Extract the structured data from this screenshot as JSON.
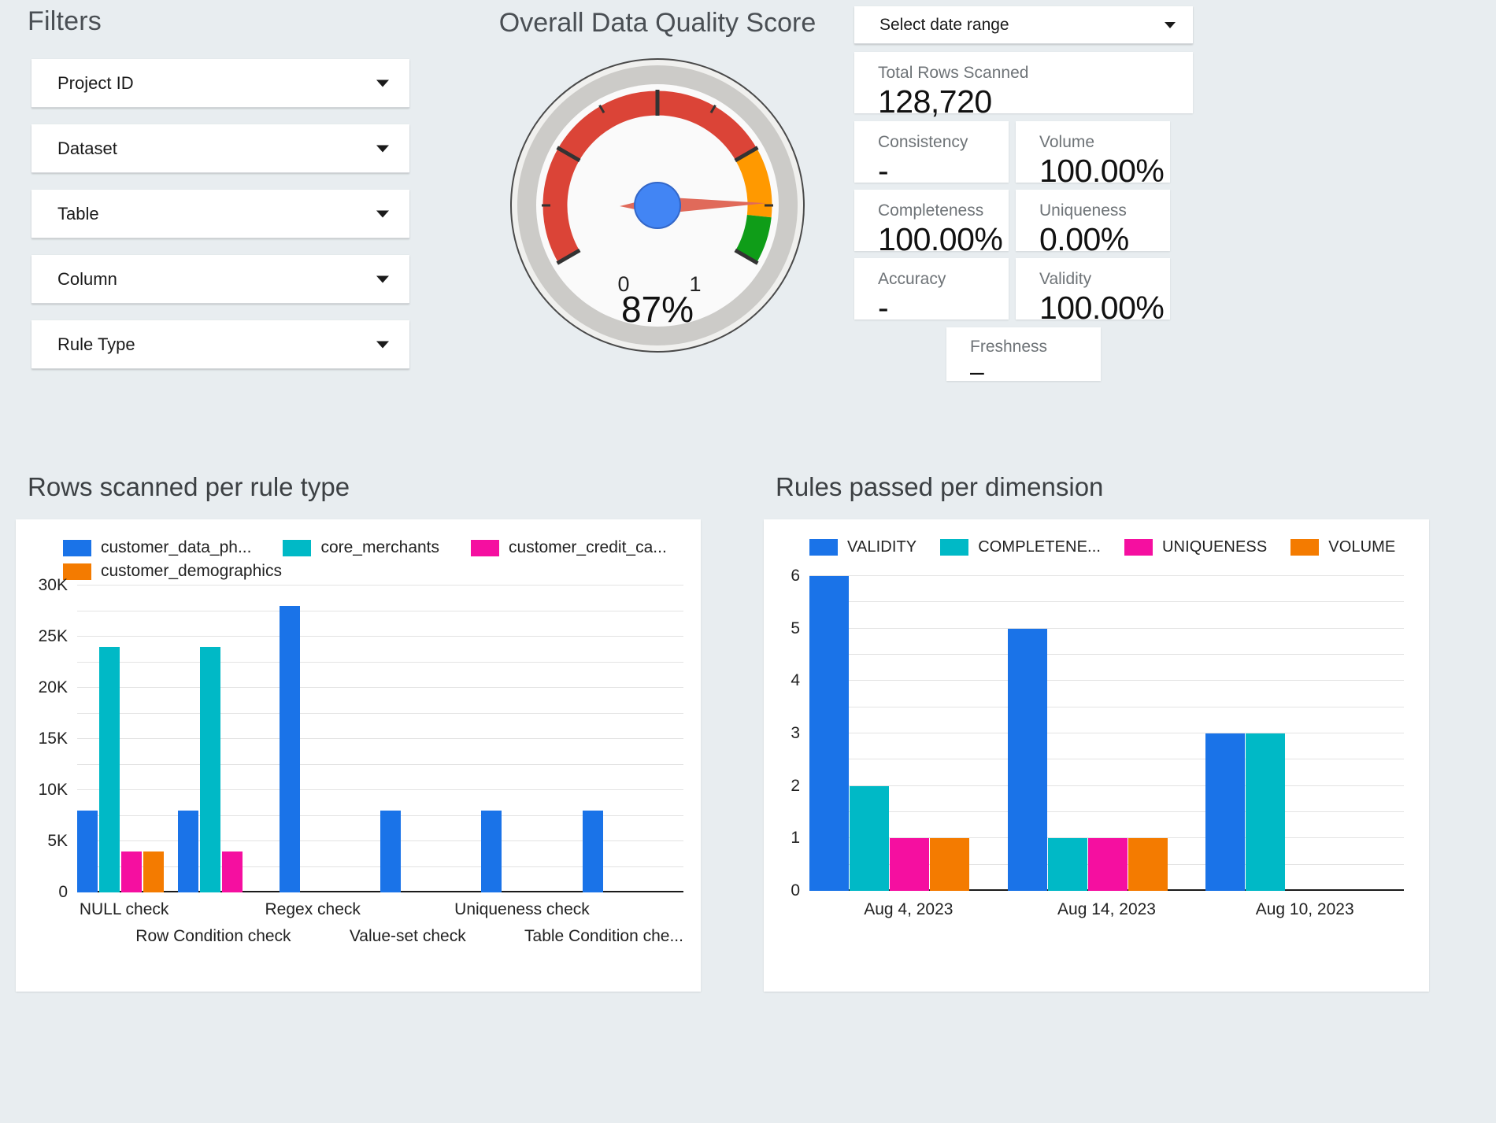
{
  "filters": {
    "title": "Filters",
    "items": [
      {
        "label": "Project ID",
        "icon": "chevron-down-icon"
      },
      {
        "label": "Dataset",
        "icon": "chevron-down-icon"
      },
      {
        "label": "Table",
        "icon": "chevron-down-icon"
      },
      {
        "label": "Column",
        "icon": "chevron-down-icon"
      },
      {
        "label": "Rule Type",
        "icon": "chevron-down-icon"
      }
    ]
  },
  "gauge": {
    "title": "Overall Data Quality Score",
    "value_label": "87%",
    "value": 0.87,
    "min_label": "0",
    "max_label": "1",
    "min": 0,
    "max": 1,
    "bands": [
      {
        "name": "poor",
        "from": 0.0,
        "to": 0.75,
        "color": "#DB4437"
      },
      {
        "name": "fair",
        "from": 0.75,
        "to": 0.9,
        "color": "#FF9900"
      },
      {
        "name": "good",
        "from": 0.9,
        "to": 1.0,
        "color": "#0F9D18"
      }
    ],
    "needle_color": "#E06A5A",
    "hub_color": "#4285F4"
  },
  "daterange": {
    "label": "Select date range",
    "icon": "chevron-down-icon"
  },
  "scorecards": {
    "total": {
      "label": "Total Rows Scanned",
      "value": "128,720"
    },
    "metrics": [
      {
        "label": "Consistency",
        "value": "-"
      },
      {
        "label": "Volume",
        "value": "100.00%"
      },
      {
        "label": "Completeness",
        "value": "100.00%"
      },
      {
        "label": "Uniqueness",
        "value": "0.00%"
      },
      {
        "label": "Accuracy",
        "value": "-"
      },
      {
        "label": "Validity",
        "value": "100.00%"
      }
    ],
    "freshness": {
      "label": "Freshness",
      "value": "–"
    }
  },
  "chart_data": [
    {
      "type": "bar",
      "title": "Rows scanned per rule type",
      "xlabel": "",
      "ylabel": "",
      "ylim": [
        0,
        30000
      ],
      "yticks": [
        0,
        5000,
        10000,
        15000,
        20000,
        25000,
        30000
      ],
      "ytick_labels": [
        "0",
        "5K",
        "10K",
        "15K",
        "20K",
        "25K",
        "30K"
      ],
      "grid": true,
      "legend_position": "top",
      "categories": [
        "NULL check",
        "Row Condition check",
        "Regex check",
        "Value-set check",
        "Uniqueness check",
        "Table Condition che..."
      ],
      "series": [
        {
          "name": "customer_data_ph...",
          "color": "#1A73E8",
          "values": [
            8000,
            8000,
            28000,
            8000,
            8000,
            8000
          ]
        },
        {
          "name": "core_merchants",
          "color": "#00B9C6",
          "values": [
            24000,
            24000,
            0,
            0,
            0,
            0
          ]
        },
        {
          "name": "customer_credit_ca...",
          "color": "#F50FA0",
          "values": [
            4000,
            4000,
            0,
            0,
            0,
            0
          ]
        },
        {
          "name": "customer_demographics",
          "color": "#F47B00",
          "values": [
            4000,
            0,
            0,
            0,
            0,
            0
          ]
        }
      ]
    },
    {
      "type": "bar",
      "title": "Rules passed per dimension",
      "xlabel": "",
      "ylabel": "",
      "ylim": [
        0,
        6
      ],
      "yticks": [
        0,
        1,
        2,
        3,
        4,
        5,
        6
      ],
      "ytick_labels": [
        "0",
        "1",
        "2",
        "3",
        "4",
        "5",
        "6"
      ],
      "grid": true,
      "legend_position": "top",
      "categories": [
        "Aug 4, 2023",
        "Aug 14, 2023",
        "Aug 10, 2023"
      ],
      "series": [
        {
          "name": "VALIDITY",
          "color": "#1A73E8",
          "values": [
            6,
            5,
            3
          ]
        },
        {
          "name": "COMPLETENE...",
          "color": "#00B9C6",
          "values": [
            2,
            1,
            3
          ]
        },
        {
          "name": "UNIQUENESS",
          "color": "#F50FA0",
          "values": [
            1,
            1,
            0
          ]
        },
        {
          "name": "VOLUME",
          "color": "#F47B00",
          "values": [
            1,
            1,
            0
          ]
        }
      ]
    }
  ],
  "theme": {
    "background": "#e8edf0",
    "card_background": "#ffffff",
    "title_color": "#4a4f54",
    "label_color": "#6e7377"
  }
}
